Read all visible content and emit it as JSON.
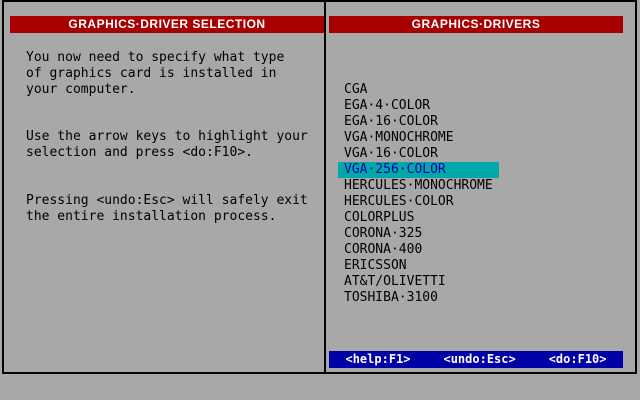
{
  "left": {
    "title": "GRAPHICS·DRIVER SELECTION",
    "paragraphs": [
      "You now need to specify what type\nof graphics card is installed in\nyour computer.",
      "Use the arrow keys to highlight your\nselection and press <do:F10>.",
      "Pressing <undo:Esc> will safely exit\nthe entire installation process."
    ]
  },
  "right": {
    "title": "GRAPHICS·DRIVERS",
    "drivers": [
      "CGA",
      "EGA·4·COLOR",
      "EGA·16·COLOR",
      "VGA·MONOCHROME",
      "VGA·16·COLOR",
      "VGA·256·COLOR",
      "HERCULES·MONOCHROME",
      "HERCULES·COLOR",
      "COLORPLUS",
      "CORONA·325",
      "CORONA·400",
      "ERICSSON",
      "AT&T/OLIVETTI",
      "TOSHIBA·3100"
    ],
    "selected_index": 5,
    "footer": {
      "help": "<help:F1>",
      "undo": "<undo:Esc>",
      "do": "<do:F10>"
    }
  },
  "colors": {
    "background": "#a8a8a8",
    "title_bar": "#a80000",
    "footer_bar": "#0000a8",
    "highlight_bg": "#00a8a8",
    "highlight_fg": "#0000a8"
  }
}
